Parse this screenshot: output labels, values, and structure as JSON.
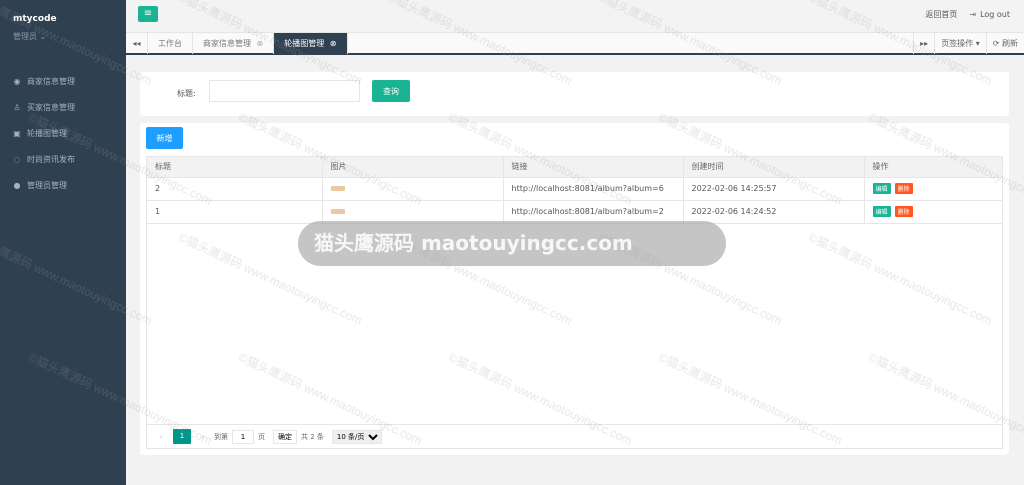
{
  "sidebar": {
    "user": "mtycode",
    "role": "管理员 ⌄",
    "items": [
      {
        "icon": "user-circle-icon",
        "glyph": "◉",
        "label": "商家信息管理"
      },
      {
        "icon": "user-icon",
        "glyph": "♙",
        "label": "买家信息管理"
      },
      {
        "icon": "image-icon",
        "glyph": "▣",
        "label": "轮播图管理"
      },
      {
        "icon": "chat-icon",
        "glyph": "◌",
        "label": "时尚资讯发布"
      },
      {
        "icon": "admin-icon",
        "glyph": "●",
        "label": "管理员管理"
      }
    ]
  },
  "header": {
    "menu_glyph": "≡",
    "home_label": "返回首页",
    "logout_glyph": "⇥",
    "logout_label": "Log out"
  },
  "tabs": {
    "prev_glyph": "◂◂",
    "items": [
      {
        "label": "工作台",
        "close": "",
        "active": false
      },
      {
        "label": "商家信息管理",
        "close": "⊗",
        "active": false
      },
      {
        "label": "轮播图管理",
        "close": "⊗",
        "active": true
      }
    ],
    "next_glyph": "▸▸",
    "tab_ops_label": "页签操作 ▾",
    "refresh_label": "⟳ 刷新"
  },
  "search": {
    "label": "标题:",
    "value": "",
    "placeholder": "",
    "button_label": "查询"
  },
  "list": {
    "add_label": "新增",
    "columns": [
      "标题",
      "图片",
      "链接",
      "创建时间",
      "操作"
    ],
    "rows": [
      {
        "title": "2",
        "link": "http://localhost:8081/album?album=6",
        "created": "2022-02-06 14:25:57",
        "edit": "编辑",
        "del": "删除"
      },
      {
        "title": "1",
        "link": "http://localhost:8081/album?album=2",
        "created": "2022-02-06 14:24:52",
        "edit": "编辑",
        "del": "删除"
      }
    ]
  },
  "pager": {
    "prev_glyph": "‹",
    "current": "1",
    "next_glyph": "›",
    "goto_label": "到第",
    "goto_value": "1",
    "page_unit": "页",
    "confirm_label": "确定",
    "total_label": "共 2 条",
    "page_size": "10 条/页"
  },
  "watermark": {
    "banner": "猫头鹰源码 maotouyingcc.com",
    "text": "©猫头鹰源码 www.maotouyingcc.com"
  },
  "colors": {
    "sidebar_bg": "#2f4050",
    "accent_green": "#1ab394",
    "add_blue": "#1e9fff",
    "delete_orange": "#ff5722",
    "pager_teal": "#009688"
  }
}
